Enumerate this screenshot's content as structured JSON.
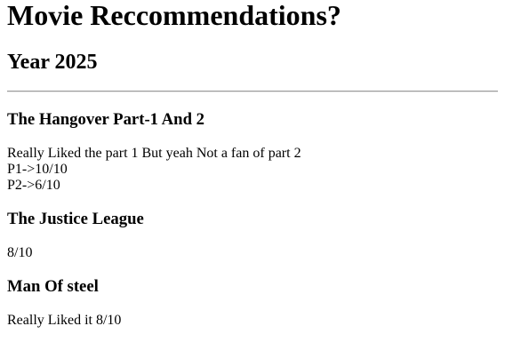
{
  "page": {
    "title": "Movie Reccommendations?",
    "subtitle": "Year 2025"
  },
  "movies": [
    {
      "title": "The Hangover Part-1 And 2",
      "lines": [
        "Really Liked the part 1 But yeah Not a fan of part 2",
        "P1->10/10",
        "P2->6/10"
      ]
    },
    {
      "title": "The Justice League",
      "lines": [
        "8/10"
      ]
    },
    {
      "title": "Man Of steel",
      "lines": [
        "Really Liked it 8/10"
      ]
    }
  ]
}
